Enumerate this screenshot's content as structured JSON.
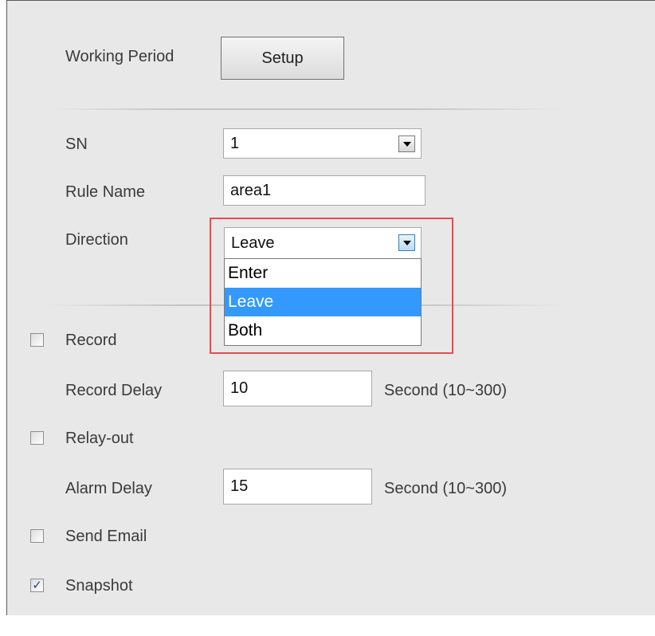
{
  "working_period": {
    "label": "Working Period",
    "button": "Setup"
  },
  "sn": {
    "label": "SN",
    "value": "1"
  },
  "rule_name": {
    "label": "Rule Name",
    "value": "area1"
  },
  "direction": {
    "label": "Direction",
    "value": "Leave",
    "options": [
      "Enter",
      "Leave",
      "Both"
    ],
    "selected": "Leave"
  },
  "record": {
    "label": "Record",
    "checked": false
  },
  "record_delay": {
    "label": "Record Delay",
    "value": "10",
    "unit": "Second (10~300)"
  },
  "relay_out": {
    "label": "Relay-out",
    "checked": false
  },
  "alarm_delay": {
    "label": "Alarm Delay",
    "value": "15",
    "unit": "Second (10~300)"
  },
  "send_email": {
    "label": "Send Email",
    "checked": false
  },
  "snapshot": {
    "label": "Snapshot",
    "checked": true
  },
  "colors": {
    "highlight": "#e05050",
    "selected_option": "#3399ff",
    "panel": "#e8e8e8"
  }
}
